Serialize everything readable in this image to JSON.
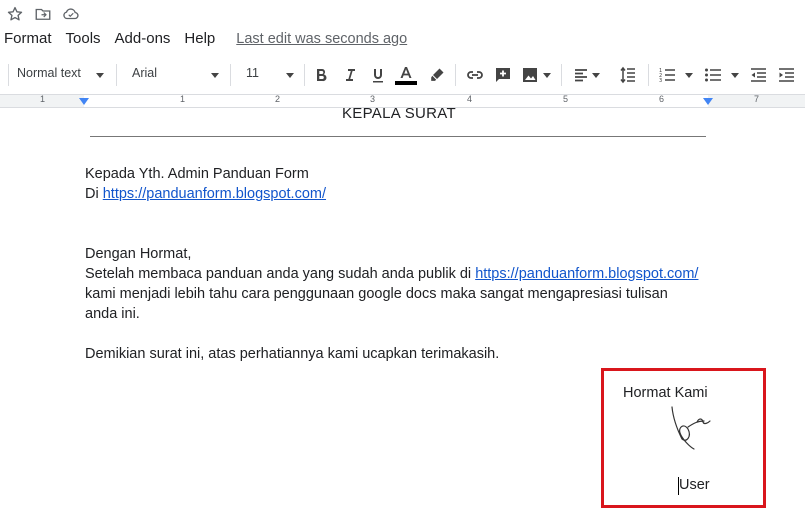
{
  "menu": {
    "items": [
      "Format",
      "Tools",
      "Add-ons",
      "Help"
    ],
    "last_edit": "Last edit was seconds ago"
  },
  "toolbar": {
    "paragraph_style": "Normal text",
    "font": "Arial",
    "font_size": "11",
    "text_color": "#000000"
  },
  "ruler": {
    "numbers": [
      "1",
      "1",
      "2",
      "3",
      "4",
      "5",
      "6",
      "7"
    ]
  },
  "document": {
    "heading": "KEPALA SURAT",
    "recipient_line1": "Kepada Yth. Admin Panduan Form",
    "recipient_line2_prefix": "Di ",
    "recipient_link": "https://panduanform.blogspot.com/",
    "greeting": "Dengan Hormat,",
    "body_line1_prefix": "Setelah membaca panduan anda yang sudah anda publik di ",
    "body_link": "https://panduanform.blogspot.com/",
    "body_line2": "kami menjadi lebih tahu cara penggunaan google docs maka sangat mengapresiasi tulisan",
    "body_line3": "anda ini.",
    "closing": "Demikian surat ini, atas perhatiannya kami ucapkan terimakasih.",
    "sign_closing": "Hormat Kami",
    "signer_name": "User"
  },
  "colors": {
    "highlight_box": "#d9161c",
    "link": "#1155cc",
    "ruler_marker": "#4285f4"
  }
}
